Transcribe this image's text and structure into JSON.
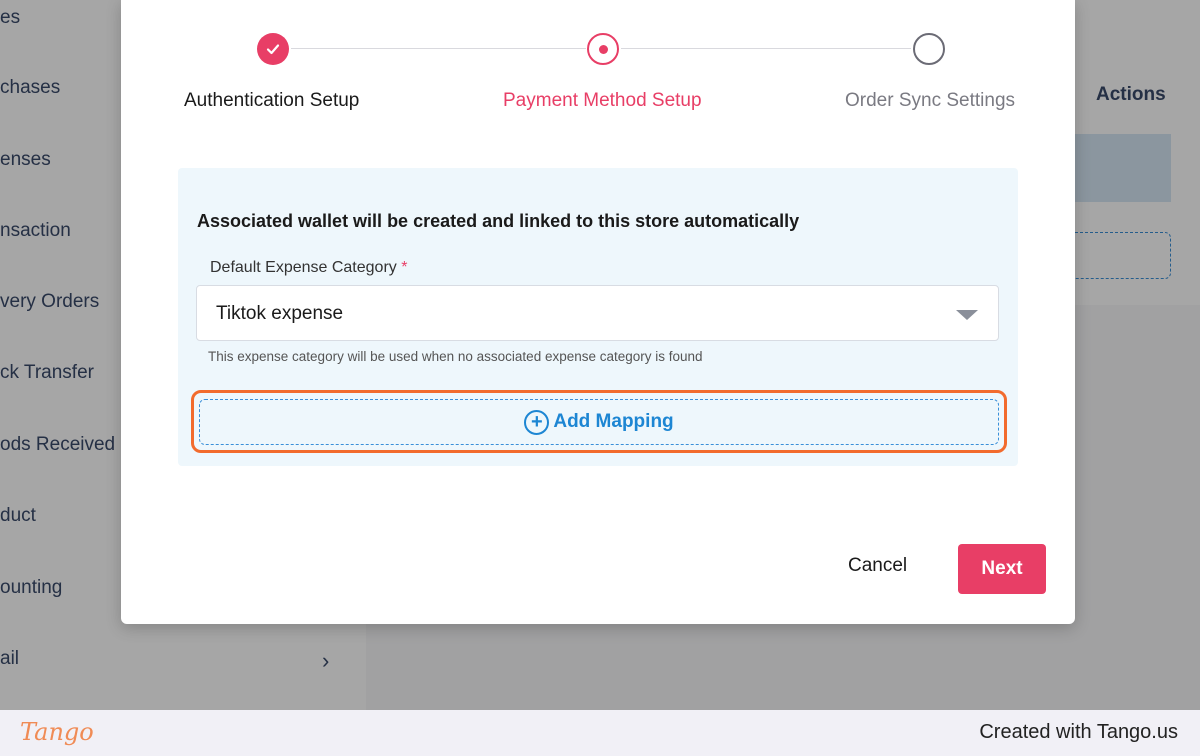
{
  "background": {
    "sidebar_items": [
      {
        "label": "es"
      },
      {
        "label": "chases"
      },
      {
        "label": "enses"
      },
      {
        "label": "nsaction"
      },
      {
        "label": "very Orders"
      },
      {
        "label": "ck Transfer"
      },
      {
        "label": "ods Received"
      },
      {
        "label": "duct"
      },
      {
        "label": "ounting"
      },
      {
        "label": "ail"
      }
    ],
    "expand_icon": "chevron-right-icon",
    "table_header_actions": "Actions"
  },
  "modal": {
    "steps": [
      {
        "label": "Authentication Setup",
        "state": "done",
        "icon": "check-icon"
      },
      {
        "label": "Payment Method Setup",
        "state": "active"
      },
      {
        "label": "Order Sync Settings",
        "state": "pending"
      }
    ],
    "panel": {
      "title": "Associated wallet will be created and linked to this store automatically",
      "field_label": "Default Expense Category",
      "required_marker": "*",
      "select_value": "Tiktok expense",
      "hint": "This expense category will be used when no associated expense category is found",
      "add_mapping_label": "Add Mapping",
      "add_mapping_icon": "plus-circle-icon"
    },
    "buttons": {
      "cancel": "Cancel",
      "next": "Next"
    }
  },
  "colors": {
    "accent": "#e83e66",
    "link_blue": "#1d86d3",
    "highlight_orange": "#f26b2d",
    "panel_bg": "#eef7fc"
  },
  "footer": {
    "logo": "Tango",
    "credit": "Created with Tango.us"
  }
}
